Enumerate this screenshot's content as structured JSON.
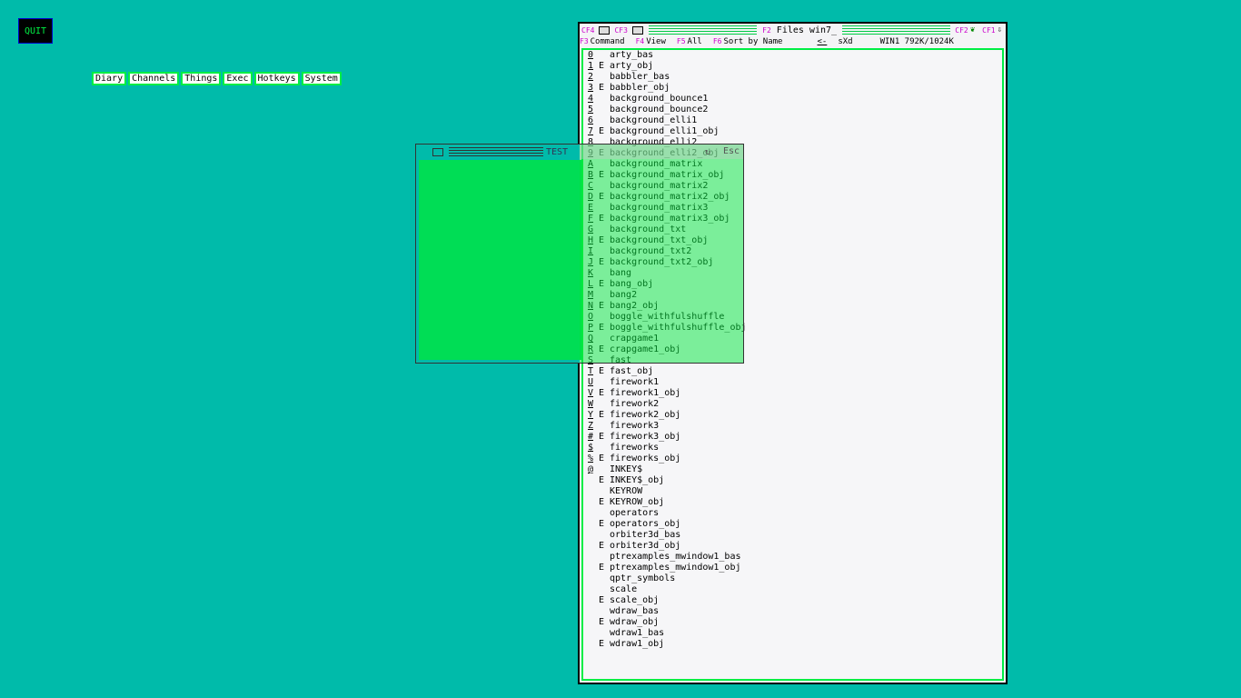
{
  "quit_label": "QUIT",
  "menu": [
    "Diary",
    "Channels",
    "Things",
    "Exec",
    "Hotkeys",
    "System"
  ],
  "files_window": {
    "cf4": "CF4",
    "cf3": "CF3",
    "title_key": "F2",
    "title": "Files win7_",
    "cf2": "CF2",
    "cf1": "CF1",
    "cmd": {
      "f3": "F3",
      "command": "Command",
      "f4": "F4",
      "view": "View",
      "f5": "F5",
      "all": "All",
      "f6": "F6",
      "sort": "Sort by Name",
      "back": "<-",
      "sxd": "sXd",
      "mem": "WIN1 792K/1024K"
    },
    "files": [
      {
        "key": "0",
        "e": "",
        "name": "arty_bas"
      },
      {
        "key": "1",
        "e": "E",
        "name": "arty_obj"
      },
      {
        "key": "2",
        "e": "",
        "name": "babbler_bas"
      },
      {
        "key": "3",
        "e": "E",
        "name": "babbler_obj"
      },
      {
        "key": "4",
        "e": "",
        "name": "background_bounce1"
      },
      {
        "key": "5",
        "e": "",
        "name": "background_bounce2"
      },
      {
        "key": "6",
        "e": "",
        "name": "background_elli1"
      },
      {
        "key": "7",
        "e": "E",
        "name": "background_elli1_obj"
      },
      {
        "key": "8",
        "e": "",
        "name": "background_elli2"
      },
      {
        "key": "9",
        "e": "E",
        "name": "background_elli2_obj"
      },
      {
        "key": "A",
        "e": "",
        "name": "background_matrix"
      },
      {
        "key": "B",
        "e": "E",
        "name": "background_matrix_obj"
      },
      {
        "key": "C",
        "e": "",
        "name": "background_matrix2"
      },
      {
        "key": "D",
        "e": "E",
        "name": "background_matrix2_obj"
      },
      {
        "key": "E",
        "e": "",
        "name": "background_matrix3"
      },
      {
        "key": "F",
        "e": "E",
        "name": "background_matrix3_obj"
      },
      {
        "key": "G",
        "e": "",
        "name": "background_txt"
      },
      {
        "key": "H",
        "e": "E",
        "name": "background_txt_obj"
      },
      {
        "key": "I",
        "e": "",
        "name": "background_txt2"
      },
      {
        "key": "J",
        "e": "E",
        "name": "background_txt2_obj"
      },
      {
        "key": "K",
        "e": "",
        "name": "bang"
      },
      {
        "key": "L",
        "e": "E",
        "name": "bang_obj"
      },
      {
        "key": "M",
        "e": "",
        "name": "bang2"
      },
      {
        "key": "N",
        "e": "E",
        "name": "bang2_obj"
      },
      {
        "key": "O",
        "e": "",
        "name": "boggle_withfulshuffle"
      },
      {
        "key": "P",
        "e": "E",
        "name": "boggle_withfulshuffle_obj"
      },
      {
        "key": "Q",
        "e": "",
        "name": "crapgame1"
      },
      {
        "key": "R",
        "e": "E",
        "name": "crapgame1_obj"
      },
      {
        "key": "S",
        "e": "",
        "name": "fast"
      },
      {
        "key": "T",
        "e": "E",
        "name": "fast_obj"
      },
      {
        "key": "U",
        "e": "",
        "name": "firework1"
      },
      {
        "key": "V",
        "e": "E",
        "name": "firework1_obj"
      },
      {
        "key": "W",
        "e": "",
        "name": "firework2"
      },
      {
        "key": "Y",
        "e": "E",
        "name": "firework2_obj"
      },
      {
        "key": "Z",
        "e": "",
        "name": "firework3"
      },
      {
        "key": "#",
        "e": "E",
        "name": "firework3_obj"
      },
      {
        "key": "$",
        "e": "",
        "name": "fireworks"
      },
      {
        "key": "%",
        "e": "E",
        "name": "fireworks_obj"
      },
      {
        "key": "@",
        "e": "",
        "name": "INKEY$"
      },
      {
        "key": "",
        "e": "E",
        "name": "INKEY$_obj"
      },
      {
        "key": "",
        "e": "",
        "name": "KEYROW"
      },
      {
        "key": "",
        "e": "E",
        "name": "KEYROW_obj"
      },
      {
        "key": "",
        "e": "",
        "name": "operators"
      },
      {
        "key": "",
        "e": "E",
        "name": "operators_obj"
      },
      {
        "key": "",
        "e": "",
        "name": "orbiter3d_bas"
      },
      {
        "key": "",
        "e": "E",
        "name": "orbiter3d_obj"
      },
      {
        "key": "",
        "e": "",
        "name": "ptrexamples_mwindow1_bas"
      },
      {
        "key": "",
        "e": "E",
        "name": "ptrexamples_mwindow1_obj"
      },
      {
        "key": "",
        "e": "",
        "name": "qptr_symbols"
      },
      {
        "key": "",
        "e": "",
        "name": "scale"
      },
      {
        "key": "",
        "e": "E",
        "name": "scale_obj"
      },
      {
        "key": "",
        "e": "",
        "name": "wdraw_bas"
      },
      {
        "key": "",
        "e": "E",
        "name": "wdraw_obj"
      },
      {
        "key": "",
        "e": "",
        "name": "wdraw1_bas"
      },
      {
        "key": "",
        "e": "E",
        "name": "wdraw1_obj"
      }
    ]
  },
  "test_window": {
    "title": "TEST",
    "esc": "Esc"
  },
  "colors": {
    "desktop": "#00bbaa",
    "accent_green": "#00ee44",
    "key_magenta": "#cc00cc"
  }
}
